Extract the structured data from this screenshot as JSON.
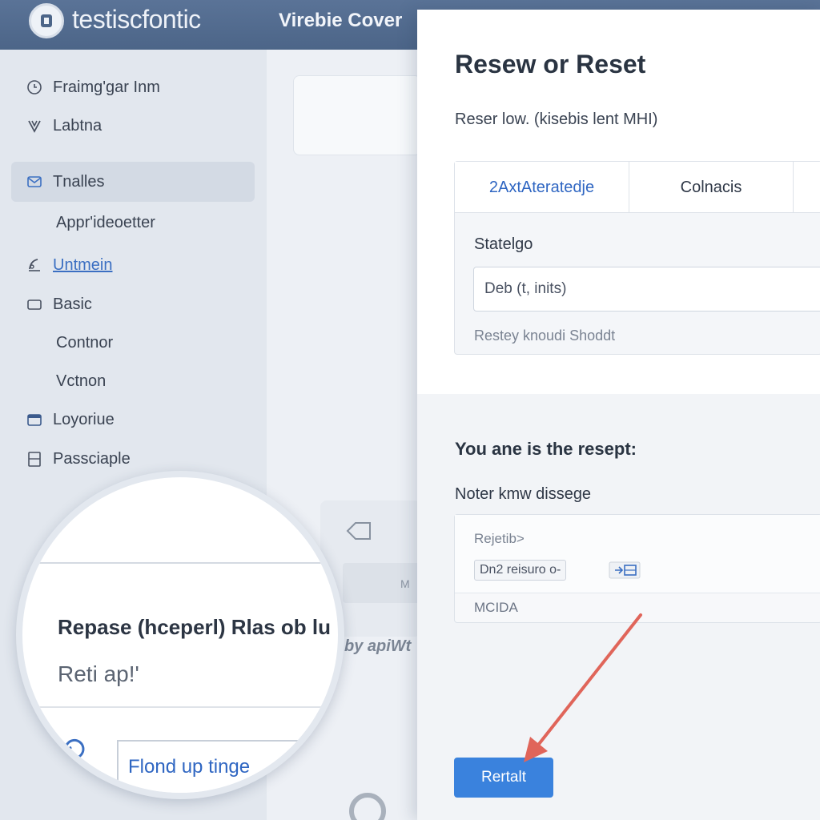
{
  "header": {
    "brand": "testiscfontic",
    "window_title": "Virebie Cover"
  },
  "sidebar": {
    "items": [
      {
        "label": "Fraimg'gar Inm",
        "icon": "clock-icon"
      },
      {
        "label": "Labtna",
        "icon": "heart-icon"
      },
      {
        "label": "Tnalles",
        "icon": "mail-icon",
        "active": true
      },
      {
        "label": "Appr'ideoetter",
        "icon": ""
      },
      {
        "label": "Untmein",
        "icon": "chart-icon",
        "link": true
      },
      {
        "label": "Basic",
        "icon": "square-icon"
      },
      {
        "label": "Contnor",
        "icon": ""
      },
      {
        "label": "Vctnon",
        "icon": ""
      },
      {
        "label": "Loyoriue",
        "icon": "calendar-icon"
      },
      {
        "label": "Passciaple",
        "icon": "document-icon"
      }
    ]
  },
  "middle": {
    "card_label": "M",
    "by_text": "by apiWt"
  },
  "dialog": {
    "title": "Resew or Reset",
    "subtitle": "Reser low. (kisebis lent MHI)",
    "tabs": [
      "2AxtAteratedje",
      "Colnacis"
    ],
    "panel_label": "Statelgo",
    "panel_input_value": "Deb (t, inits)",
    "panel_hint": "Restey knoudi Shoddt",
    "section_heading": "You ane is the resept:",
    "message_label": "Noter kmw dissege",
    "message_line": "Rejetib>",
    "message_chip": "Dn2 reisuro o-",
    "message_footer": "MCIDA",
    "reset_button": "Rertalt"
  },
  "magnifier": {
    "title": "Repase (hceperl) Rlas ob lu",
    "subtitle": "Reti ap!'",
    "input_value": "Flond up tinge"
  },
  "colors": {
    "topbar": "#4c6588",
    "accent": "#3a82dd",
    "link": "#2f66c2",
    "arrow": "#e0655a"
  }
}
